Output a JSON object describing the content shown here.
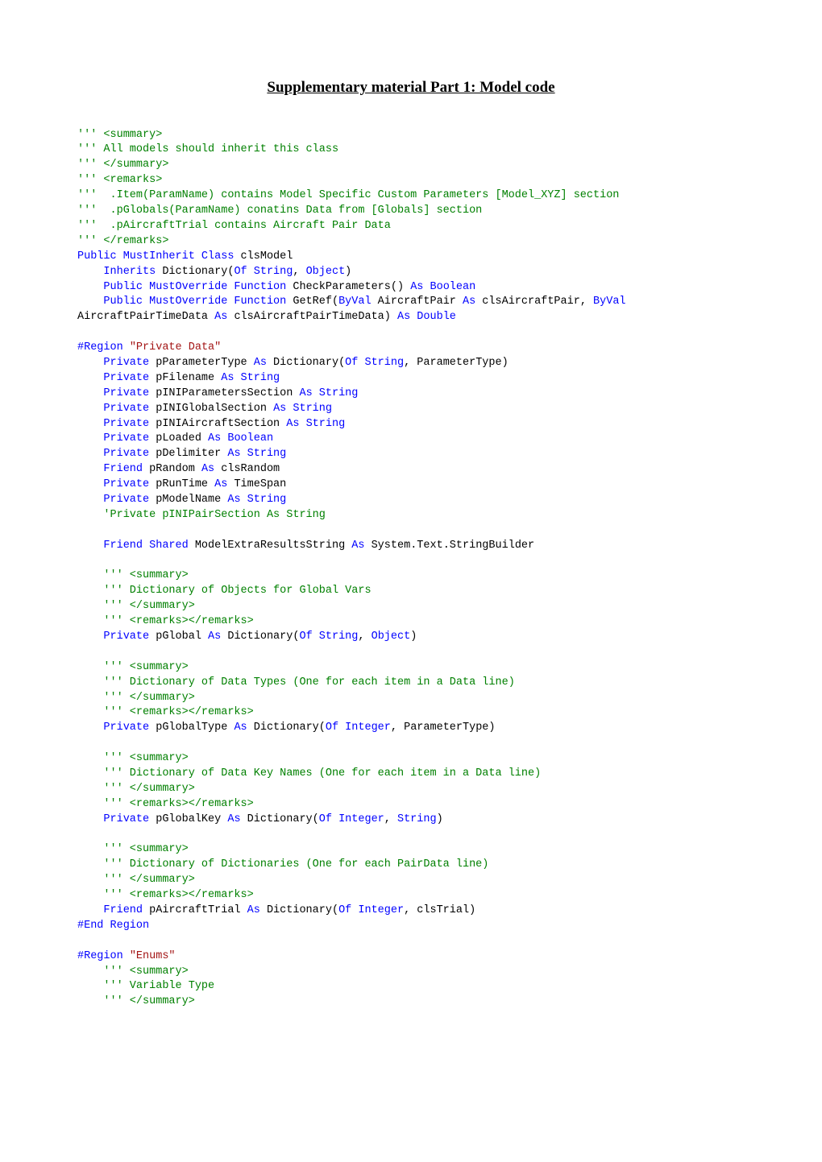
{
  "title": "Supplementary material Part 1: Model code",
  "code_spans": [
    {
      "cls": "c-comment",
      "t": "''' <summary>\n''' All models should inherit this class\n''' </summary>\n''' <remarks>\n'''  .Item(ParamName) contains Model Specific Custom Parameters [Model_XYZ] section\n'''  .pGlobals(ParamName) conatins Data from [Globals] section\n'''  .pAircraftTrial contains Aircraft Pair Data\n''' </remarks>\n"
    },
    {
      "cls": "c-keyword",
      "t": "Public MustInherit Class"
    },
    {
      "cls": "c-text",
      "t": " clsModel\n    "
    },
    {
      "cls": "c-keyword",
      "t": "Inherits"
    },
    {
      "cls": "c-text",
      "t": " Dictionary("
    },
    {
      "cls": "c-keyword",
      "t": "Of String"
    },
    {
      "cls": "c-text",
      "t": ", "
    },
    {
      "cls": "c-keyword",
      "t": "Object"
    },
    {
      "cls": "c-text",
      "t": ")\n    "
    },
    {
      "cls": "c-keyword",
      "t": "Public MustOverride Function"
    },
    {
      "cls": "c-text",
      "t": " CheckParameters() "
    },
    {
      "cls": "c-keyword",
      "t": "As Boolean"
    },
    {
      "cls": "c-text",
      "t": "\n    "
    },
    {
      "cls": "c-keyword",
      "t": "Public MustOverride Function"
    },
    {
      "cls": "c-text",
      "t": " GetRef("
    },
    {
      "cls": "c-keyword",
      "t": "ByVal"
    },
    {
      "cls": "c-text",
      "t": " AircraftPair "
    },
    {
      "cls": "c-keyword",
      "t": "As"
    },
    {
      "cls": "c-text",
      "t": " clsAircraftPair, "
    },
    {
      "cls": "c-keyword",
      "t": "ByVal"
    },
    {
      "cls": "c-text",
      "t": " AircraftPairTimeData "
    },
    {
      "cls": "c-keyword",
      "t": "As"
    },
    {
      "cls": "c-text",
      "t": " clsAircraftPairTimeData) "
    },
    {
      "cls": "c-keyword",
      "t": "As Double"
    },
    {
      "cls": "c-text",
      "t": "\n\n"
    },
    {
      "cls": "c-keyword",
      "t": "#Region"
    },
    {
      "cls": "c-text",
      "t": " "
    },
    {
      "cls": "c-string",
      "t": "\"Private Data\""
    },
    {
      "cls": "c-text",
      "t": "\n    "
    },
    {
      "cls": "c-keyword",
      "t": "Private"
    },
    {
      "cls": "c-text",
      "t": " pParameterType "
    },
    {
      "cls": "c-keyword",
      "t": "As"
    },
    {
      "cls": "c-text",
      "t": " Dictionary("
    },
    {
      "cls": "c-keyword",
      "t": "Of String"
    },
    {
      "cls": "c-text",
      "t": ", ParameterType)\n    "
    },
    {
      "cls": "c-keyword",
      "t": "Private"
    },
    {
      "cls": "c-text",
      "t": " pFilename "
    },
    {
      "cls": "c-keyword",
      "t": "As String"
    },
    {
      "cls": "c-text",
      "t": "\n    "
    },
    {
      "cls": "c-keyword",
      "t": "Private"
    },
    {
      "cls": "c-text",
      "t": " pINIParametersSection "
    },
    {
      "cls": "c-keyword",
      "t": "As String"
    },
    {
      "cls": "c-text",
      "t": "\n    "
    },
    {
      "cls": "c-keyword",
      "t": "Private"
    },
    {
      "cls": "c-text",
      "t": " pINIGlobalSection "
    },
    {
      "cls": "c-keyword",
      "t": "As String"
    },
    {
      "cls": "c-text",
      "t": "\n    "
    },
    {
      "cls": "c-keyword",
      "t": "Private"
    },
    {
      "cls": "c-text",
      "t": " pINIAircraftSection "
    },
    {
      "cls": "c-keyword",
      "t": "As String"
    },
    {
      "cls": "c-text",
      "t": "\n    "
    },
    {
      "cls": "c-keyword",
      "t": "Private"
    },
    {
      "cls": "c-text",
      "t": " pLoaded "
    },
    {
      "cls": "c-keyword",
      "t": "As Boolean"
    },
    {
      "cls": "c-text",
      "t": "\n    "
    },
    {
      "cls": "c-keyword",
      "t": "Private"
    },
    {
      "cls": "c-text",
      "t": " pDelimiter "
    },
    {
      "cls": "c-keyword",
      "t": "As String"
    },
    {
      "cls": "c-text",
      "t": "\n    "
    },
    {
      "cls": "c-keyword",
      "t": "Friend"
    },
    {
      "cls": "c-text",
      "t": " pRandom "
    },
    {
      "cls": "c-keyword",
      "t": "As"
    },
    {
      "cls": "c-text",
      "t": " clsRandom\n    "
    },
    {
      "cls": "c-keyword",
      "t": "Private"
    },
    {
      "cls": "c-text",
      "t": " pRunTime "
    },
    {
      "cls": "c-keyword",
      "t": "As"
    },
    {
      "cls": "c-text",
      "t": " TimeSpan\n    "
    },
    {
      "cls": "c-keyword",
      "t": "Private"
    },
    {
      "cls": "c-text",
      "t": " pModelName "
    },
    {
      "cls": "c-keyword",
      "t": "As String"
    },
    {
      "cls": "c-text",
      "t": "\n    "
    },
    {
      "cls": "c-comment",
      "t": "'Private pINIPairSection As String"
    },
    {
      "cls": "c-text",
      "t": "\n\n    "
    },
    {
      "cls": "c-keyword",
      "t": "Friend Shared"
    },
    {
      "cls": "c-text",
      "t": " ModelExtraResultsString "
    },
    {
      "cls": "c-keyword",
      "t": "As"
    },
    {
      "cls": "c-text",
      "t": " System.Text.StringBuilder\n\n    "
    },
    {
      "cls": "c-comment",
      "t": "''' <summary>\n    ''' Dictionary of Objects for Global Vars\n    ''' </summary>\n    ''' <remarks></remarks>"
    },
    {
      "cls": "c-text",
      "t": "\n    "
    },
    {
      "cls": "c-keyword",
      "t": "Private"
    },
    {
      "cls": "c-text",
      "t": " pGlobal "
    },
    {
      "cls": "c-keyword",
      "t": "As"
    },
    {
      "cls": "c-text",
      "t": " Dictionary("
    },
    {
      "cls": "c-keyword",
      "t": "Of String"
    },
    {
      "cls": "c-text",
      "t": ", "
    },
    {
      "cls": "c-keyword",
      "t": "Object"
    },
    {
      "cls": "c-text",
      "t": ")\n\n    "
    },
    {
      "cls": "c-comment",
      "t": "''' <summary>\n    ''' Dictionary of Data Types (One for each item in a Data line)\n    ''' </summary>\n    ''' <remarks></remarks>"
    },
    {
      "cls": "c-text",
      "t": "\n    "
    },
    {
      "cls": "c-keyword",
      "t": "Private"
    },
    {
      "cls": "c-text",
      "t": " pGlobalType "
    },
    {
      "cls": "c-keyword",
      "t": "As"
    },
    {
      "cls": "c-text",
      "t": " Dictionary("
    },
    {
      "cls": "c-keyword",
      "t": "Of Integer"
    },
    {
      "cls": "c-text",
      "t": ", ParameterType)\n\n    "
    },
    {
      "cls": "c-comment",
      "t": "''' <summary>\n    ''' Dictionary of Data Key Names (One for each item in a Data line)\n    ''' </summary>\n    ''' <remarks></remarks>"
    },
    {
      "cls": "c-text",
      "t": "\n    "
    },
    {
      "cls": "c-keyword",
      "t": "Private"
    },
    {
      "cls": "c-text",
      "t": " pGlobalKey "
    },
    {
      "cls": "c-keyword",
      "t": "As"
    },
    {
      "cls": "c-text",
      "t": " Dictionary("
    },
    {
      "cls": "c-keyword",
      "t": "Of Integer"
    },
    {
      "cls": "c-text",
      "t": ", "
    },
    {
      "cls": "c-keyword",
      "t": "String"
    },
    {
      "cls": "c-text",
      "t": ")\n\n    "
    },
    {
      "cls": "c-comment",
      "t": "''' <summary>\n    ''' Dictionary of Dictionaries (One for each PairData line)\n    ''' </summary>\n    ''' <remarks></remarks>"
    },
    {
      "cls": "c-text",
      "t": "\n    "
    },
    {
      "cls": "c-keyword",
      "t": "Friend"
    },
    {
      "cls": "c-text",
      "t": " pAircraftTrial "
    },
    {
      "cls": "c-keyword",
      "t": "As"
    },
    {
      "cls": "c-text",
      "t": " Dictionary("
    },
    {
      "cls": "c-keyword",
      "t": "Of Integer"
    },
    {
      "cls": "c-text",
      "t": ", clsTrial)\n"
    },
    {
      "cls": "c-keyword",
      "t": "#End Region"
    },
    {
      "cls": "c-text",
      "t": "\n\n"
    },
    {
      "cls": "c-keyword",
      "t": "#Region"
    },
    {
      "cls": "c-text",
      "t": " "
    },
    {
      "cls": "c-string",
      "t": "\"Enums\""
    },
    {
      "cls": "c-text",
      "t": "\n    "
    },
    {
      "cls": "c-comment",
      "t": "''' <summary>\n    ''' Variable Type\n    ''' </summary>"
    }
  ]
}
